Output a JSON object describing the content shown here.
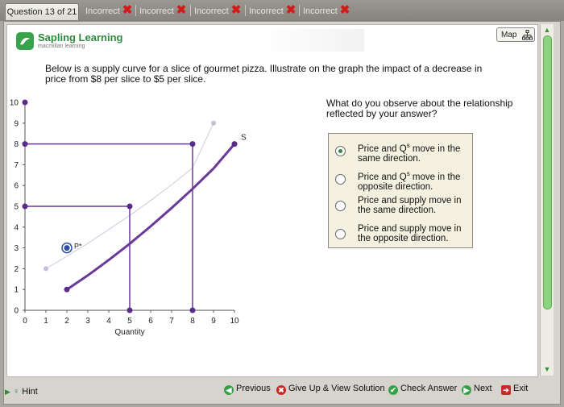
{
  "topbar": {
    "question_tab": "Question 13 of 21",
    "attempts": [
      {
        "label": "Incorrect",
        "mark": "✖"
      },
      {
        "label": "Incorrect",
        "mark": "✖"
      },
      {
        "label": "Incorrect",
        "mark": "✖"
      },
      {
        "label": "Incorrect",
        "mark": "✖"
      },
      {
        "label": "Incorrect",
        "mark": "✖"
      }
    ]
  },
  "brand": {
    "name": "Sapling Learning",
    "tagline": "macmillan learning",
    "color": "#2d8a3c"
  },
  "map_button": {
    "label": "Map",
    "icon": "sitemap-icon"
  },
  "prompt": "Below is a supply curve for a slice of gourmet pizza. Illustrate on the graph the impact of a decrease in price from $8 per slice to $5 per slice.",
  "question2": "What do you observe about the relationship reflected by your answer?",
  "choices": [
    {
      "pre": "Price and Q",
      "sup": "s",
      "post": " move in the same direction.",
      "selected": true
    },
    {
      "pre": "Price and Q",
      "sup": "s",
      "post": " move in the opposite direction.",
      "selected": false
    },
    {
      "pre": "Price and supply move in the same direction.",
      "sup": "",
      "post": "",
      "selected": false
    },
    {
      "pre": "Price and supply move in the opposite direction.",
      "sup": "",
      "post": "",
      "selected": false
    }
  ],
  "chart_data": {
    "type": "line",
    "xlabel": "Quantity",
    "x_ticks": [
      "0",
      "1",
      "2",
      "3",
      "4",
      "5",
      "6",
      "7",
      "8",
      "9",
      "10"
    ],
    "y_ticks": [
      "0",
      "1",
      "2",
      "3",
      "4",
      "5",
      "6",
      "7",
      "8",
      "9",
      "10"
    ],
    "xlim": [
      0,
      10
    ],
    "ylim": [
      0,
      10
    ],
    "series": [
      {
        "name": "S",
        "color": "#6a3a9a",
        "points": [
          [
            2,
            1
          ],
          [
            3,
            1.68
          ],
          [
            4,
            2.42
          ],
          [
            5,
            3.2
          ],
          [
            6,
            4.04
          ],
          [
            7,
            4.92
          ],
          [
            8,
            5.84
          ],
          [
            9,
            6.82
          ],
          [
            10,
            8
          ]
        ]
      },
      {
        "name": "",
        "color": "#d7d0e2",
        "points": [
          [
            1,
            2
          ],
          [
            2,
            2.6
          ],
          [
            3,
            3.22
          ],
          [
            4,
            3.88
          ],
          [
            5,
            4.56
          ],
          [
            6,
            5.28
          ],
          [
            7,
            6.04
          ],
          [
            8,
            6.85
          ],
          [
            9,
            9
          ]
        ]
      }
    ],
    "price_lines": [
      {
        "price": 8,
        "quantity": 8
      },
      {
        "price": 5,
        "quantity": 5
      }
    ],
    "movable_point": {
      "label": "P*",
      "x": 2,
      "y": 3
    }
  },
  "bottom": {
    "hint": "Hint",
    "previous": "Previous",
    "giveup": "Give Up & View Solution",
    "check": "Check Answer",
    "next": "Next",
    "exit": "Exit"
  }
}
